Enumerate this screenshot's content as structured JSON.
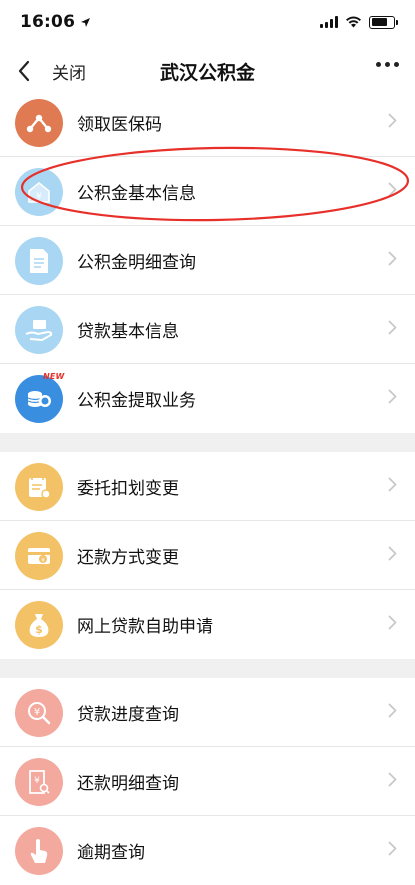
{
  "status_bar": {
    "time": "16:06",
    "battery_level": 0.8
  },
  "nav": {
    "close_label": "关闭",
    "title": "武汉公积金"
  },
  "sections": [
    {
      "items": [
        {
          "label": "领取医保码",
          "icon": "health-code-icon",
          "color": "#e07a52"
        },
        {
          "label": "公积金基本信息",
          "icon": "house-fund-icon",
          "color": "#a9d6f2"
        },
        {
          "label": "公积金明细查询",
          "icon": "document-icon",
          "color": "#a9d6f2"
        },
        {
          "label": "贷款基本信息",
          "icon": "loan-hand-icon",
          "color": "#a9d6f2"
        },
        {
          "label": "公积金提取业务",
          "icon": "coins-icon",
          "color": "#3a8ee0",
          "badge": "NEW"
        }
      ]
    },
    {
      "items": [
        {
          "label": "委托扣划变更",
          "icon": "calendar-edit-icon",
          "color": "#f3c266"
        },
        {
          "label": "还款方式变更",
          "icon": "repay-card-icon",
          "color": "#f3c266"
        },
        {
          "label": "网上贷款自助申请",
          "icon": "money-bag-icon",
          "color": "#f3c266"
        }
      ]
    },
    {
      "items": [
        {
          "label": "贷款进度查询",
          "icon": "search-yen-icon",
          "color": "#f3a99e"
        },
        {
          "label": "还款明细查询",
          "icon": "receipt-search-icon",
          "color": "#f3a99e"
        },
        {
          "label": "逾期查询",
          "icon": "touch-icon",
          "color": "#f3a99e"
        }
      ]
    }
  ],
  "colors": {
    "annotation": "#e8302a",
    "chevron": "#c8c8c8",
    "section_gap": "#f0f0f0"
  }
}
